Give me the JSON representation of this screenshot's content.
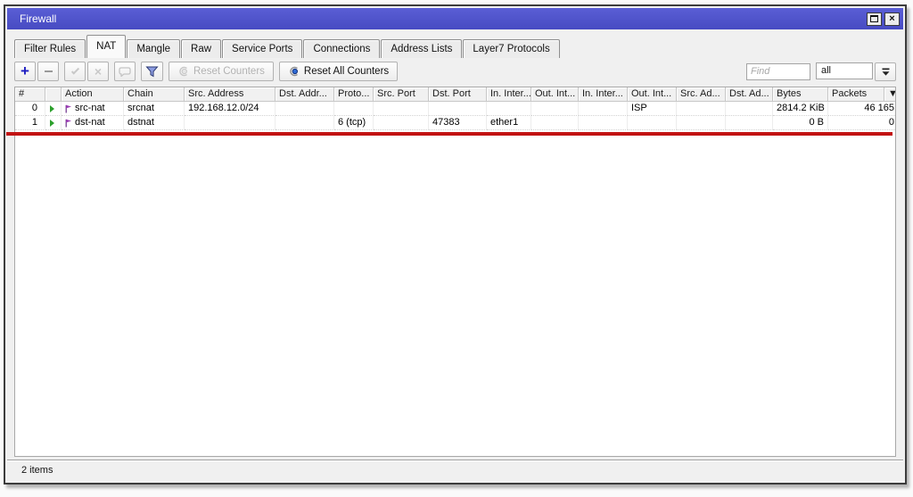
{
  "window": {
    "title": "Firewall",
    "close_glyph": "×"
  },
  "tabs": {
    "items": [
      "Filter Rules",
      "NAT",
      "Mangle",
      "Raw",
      "Service Ports",
      "Connections",
      "Address Lists",
      "Layer7 Protocols"
    ],
    "active": "NAT"
  },
  "toolbar": {
    "add_glyph": "+",
    "disable_glyph": "×",
    "reset_counters_label": "Reset Counters",
    "reset_all_counters_label": "Reset All Counters",
    "find_placeholder": "Find",
    "scope_value": "all"
  },
  "table": {
    "columns": [
      "#",
      "",
      "Action",
      "Chain",
      "Src. Address",
      "Dst. Addr...",
      "Proto...",
      "Src. Port",
      "Dst. Port",
      "In. Inter...",
      "Out. Int...",
      "In. Inter...",
      "Out. Int...",
      "Src. Ad...",
      "Dst. Ad...",
      "Bytes",
      "Packets"
    ],
    "selector_glyph": "▼",
    "rows": [
      {
        "num": "0",
        "action": "src-nat",
        "chain": "srcnat",
        "src_address": "192.168.12.0/24",
        "dst_address": "",
        "protocol": "",
        "src_port": "",
        "dst_port": "",
        "in_interface": "",
        "out_interface": "",
        "in_interface_list": "",
        "out_interface_list": "ISP",
        "src_address_list": "",
        "dst_address_list": "",
        "bytes": "2814.2 KiB",
        "packets": "46 165"
      },
      {
        "num": "1",
        "action": "dst-nat",
        "chain": "dstnat",
        "src_address": "",
        "dst_address": "",
        "protocol": "6 (tcp)",
        "src_port": "",
        "dst_port": "47383",
        "in_interface": "ether1",
        "out_interface": "",
        "in_interface_list": "",
        "out_interface_list": "",
        "src_address_list": "",
        "dst_address_list": "",
        "bytes": "0 B",
        "packets": "0"
      }
    ]
  },
  "annotation": {
    "type": "red-underline",
    "below_row_index": 1,
    "color": "#c21313"
  },
  "status": {
    "items_count": "2 items"
  },
  "colors": {
    "titlebar": "#4d51cb",
    "annotation_red": "#c21313",
    "add_button_blue": "#1b1bc0",
    "funnel_blue": "#8c9ce0",
    "action_arrow_green": "#2ca02c",
    "action_flag_purple": "#9b3bb5"
  }
}
